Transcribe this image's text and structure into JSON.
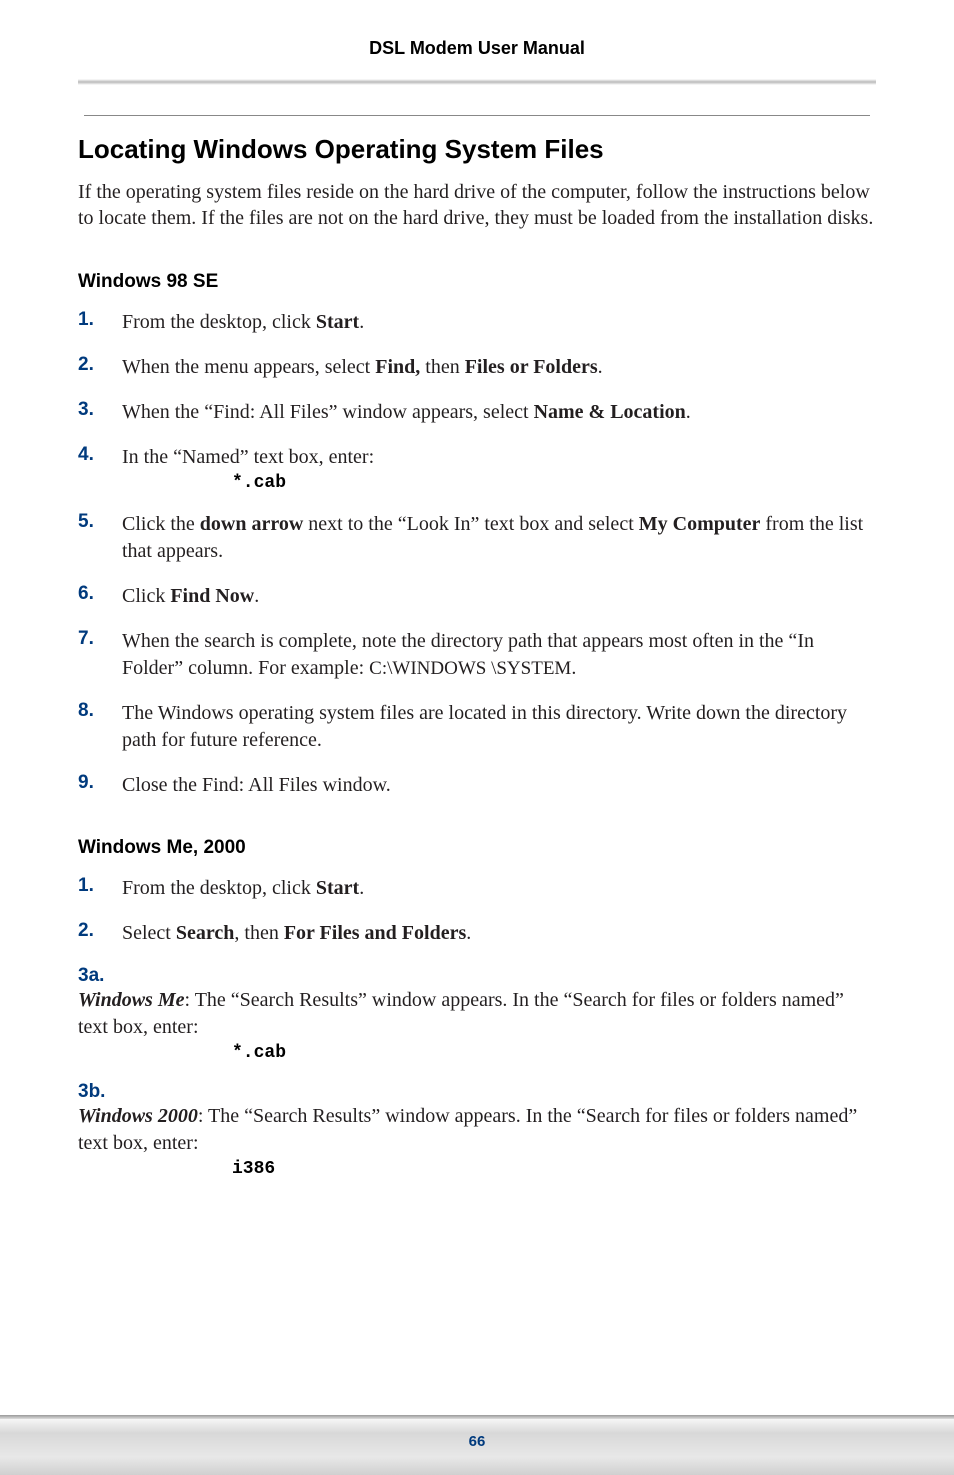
{
  "header": "DSL Modem User Manual",
  "title": "Locating Windows Operating System Files",
  "intro": "If the operating system files reside on the hard drive of the computer, follow the instructions below to locate them. If the files are not on the hard drive, they must be loaded from the installation disks.",
  "win98": {
    "heading": "Windows 98 SE",
    "steps": [
      {
        "num": "1.",
        "pre": "From the desktop, click ",
        "b1": "Start",
        "post": "."
      },
      {
        "num": "2.",
        "pre": "When the menu appears, select ",
        "b1": "Find,",
        "mid": " then ",
        "b2": "Files or Folders",
        "post": "."
      },
      {
        "num": "3.",
        "pre": "When the “Find: All Files” window appears, select ",
        "b1": "Name & Location",
        "post": "."
      },
      {
        "num": "4.",
        "pre": "In the “Named” text box, enter:",
        "code": "*.cab"
      },
      {
        "num": "5.",
        "pre": "Click the ",
        "b1": "down arrow",
        "mid": "  next to the “Look In” text box and select ",
        "b2": "My Computer",
        "post": " from the list that appears."
      },
      {
        "num": "6.",
        "pre": "Click ",
        "b1": "Find Now",
        "post": "."
      },
      {
        "num": "7.",
        "pre": " When the search is complete, note the directory path that appears most often in the “In Folder” column. For example: ",
        "sc": "C:\\WINDOWS \\SYSTEM",
        "post": "."
      },
      {
        "num": "8.",
        "pre": "The Windows operating system files are located in this directory. Write down the directory path for future reference."
      },
      {
        "num": "9.",
        "pre": " Close the Find: All Files window."
      }
    ]
  },
  "winme": {
    "heading": "Windows Me, 2000",
    "steps": [
      {
        "num": "1.",
        "pre": "From the desktop, click ",
        "b1": "Start",
        "post": "."
      },
      {
        "num": "2.",
        "pre": "Select ",
        "b1": "Search",
        "mid": ", then ",
        "b2": "For Files and Folders",
        "post": "."
      },
      {
        "num": "3a.",
        "em": "Windows Me",
        "pre": ": The “Search Results” window appears. In the “Search for files or folders named” text box, enter:",
        "code": "*.cab"
      },
      {
        "num": "3b.",
        "em": "Windows 2000",
        "pre": ": The “Search Results” window appears. In the “Search for files or folders named” text box, enter:",
        "code": "i386"
      }
    ]
  },
  "pageNum": "66"
}
